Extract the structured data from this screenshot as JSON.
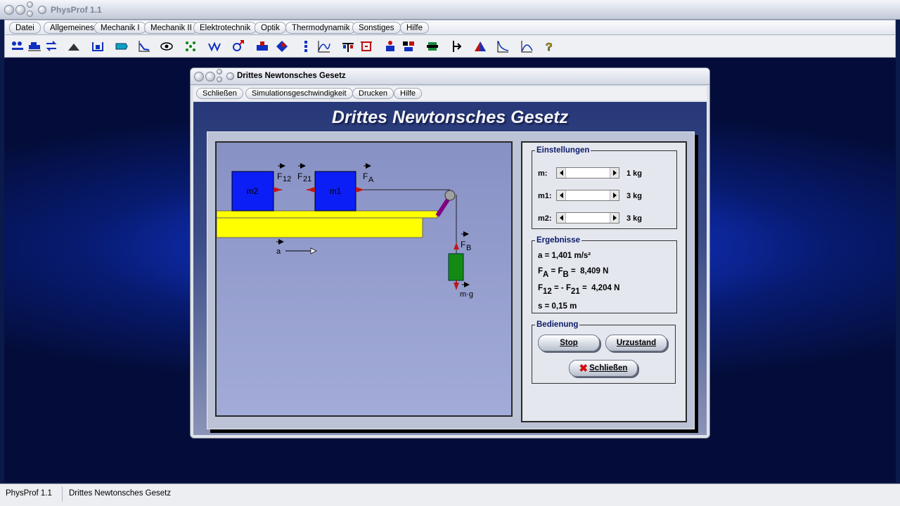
{
  "app": {
    "title": "PhysProf 1.1"
  },
  "menu": [
    "Datei",
    "Allgemeines",
    "Mechanik I",
    "Mechanik II",
    "Elektrotechnik",
    "Optik",
    "Thermodynamik",
    "Sonstiges",
    "Hilfe"
  ],
  "toolbar_icons": [
    "forces-icon",
    "car-icon",
    "swap-icon",
    "ramp-icon",
    "scale-icon",
    "lever-icon",
    "graph-icon",
    "eye-icon",
    "molecule-icon",
    "wave-icon",
    "gender-icon",
    "magnet-icon",
    "lens-icon",
    "column-icon",
    "curve-icon",
    "balance-icon",
    "circuit-icon",
    "person-icon",
    "camera-icon",
    "gear-icon",
    "piston-icon",
    "triangle-icon",
    "decay-icon",
    "spectrum-icon",
    "help-icon"
  ],
  "window": {
    "title": "Drittes Newtonsches Gesetz",
    "menu": [
      "Schließen",
      "Simulationsgeschwindigkeit",
      "Drucken",
      "Hilfe"
    ],
    "heading": "Drittes Newtonsches Gesetz"
  },
  "simulation": {
    "block_m2": "m2",
    "block_m1": "m1",
    "label_f12": "F",
    "label_f12_sub": "12",
    "label_f21": "F",
    "label_f21_sub": "21",
    "label_fa": "F",
    "label_fa_sub": "A",
    "label_fb": "F",
    "label_fb_sub": "B",
    "label_a": "a",
    "label_mg": "m·g",
    "colors": {
      "blocks": "#0b1ef5",
      "table": "#ffff00",
      "weight": "#148a14",
      "arrows": "#c01818"
    }
  },
  "settings": {
    "title": "Einstellungen",
    "rows": [
      {
        "label": "m:",
        "value": "1 kg"
      },
      {
        "label": "m1:",
        "value": "3 kg"
      },
      {
        "label": "m2:",
        "value": "3 kg"
      }
    ]
  },
  "results": {
    "title": "Ergebnisse",
    "a": "a = 1,401 m/s²",
    "fa_fb_value": "8,409 N",
    "f12_f21_value": "4,204 N",
    "s": "s = 0,15 m"
  },
  "controls": {
    "title": "Bedienung",
    "stop": "Stop",
    "reset": "Urzustand",
    "close": "Schließen"
  },
  "status": {
    "app": "PhysProf 1.1",
    "document": "Drittes Newtonsches Gesetz"
  }
}
